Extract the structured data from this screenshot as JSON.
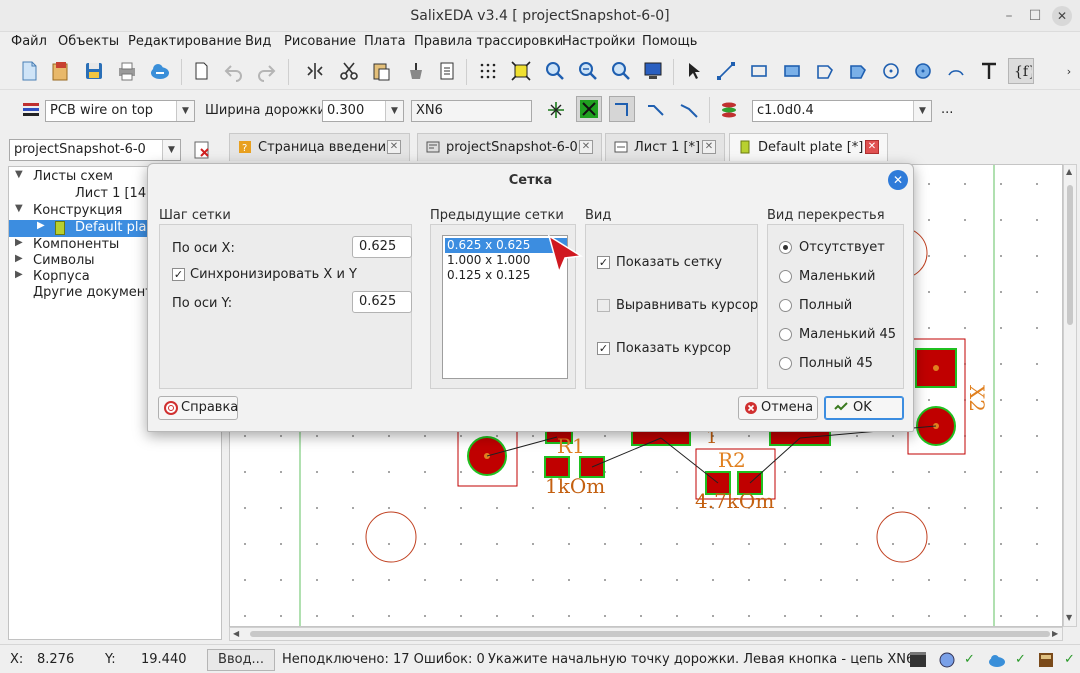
{
  "window": {
    "title": "SalixEDA v3.4 [ projectSnapshot-6-0]"
  },
  "menu": [
    "Файл",
    "Объекты",
    "Редактирование",
    "Вид",
    "Рисование",
    "Плата",
    "Правила трассировки",
    "Настройки",
    "Помощь"
  ],
  "toolbar2": {
    "layer_combo": "PCB wire on top",
    "width_label": "Ширина дорожки:",
    "width_value": "0.300",
    "net_value": "XN6",
    "rule_combo": "c1.0d0.4",
    "more": "..."
  },
  "project_combo": "projectSnapshot-6-0",
  "tabs": [
    {
      "label": "Страница введения"
    },
    {
      "label": "projectSnapshot-6-0"
    },
    {
      "label": "Лист 1 [*]"
    },
    {
      "label": "Default plate [*]"
    }
  ],
  "tree": {
    "items": [
      {
        "label": "Листы схем"
      },
      {
        "label": "Лист 1 [14"
      },
      {
        "label": "Конструкция"
      },
      {
        "label": "Default pla"
      },
      {
        "label": "Компоненты"
      },
      {
        "label": "Символы"
      },
      {
        "label": "Корпуса"
      },
      {
        "label": "Другие документ"
      }
    ]
  },
  "canvas": {
    "labels": {
      "r1": "R1",
      "r1_value": "1kOm",
      "r2": "R2",
      "r2_value": "4.7kOm",
      "x2": "X2",
      "partial": "1"
    },
    "colors": {
      "copper": "#c00000",
      "outline": "#20c020",
      "silk": "#e08020",
      "hole": "#c04020",
      "board_edge": "#60c060"
    }
  },
  "dialog": {
    "title": "Сетка",
    "grid_step": {
      "title": "Шаг сетки",
      "x_label": "По оси X:",
      "x_value": "0.625",
      "sync_label": "Синхронизировать X и Y",
      "sync_checked": true,
      "y_label": "По оси Y:",
      "y_value": "0.625"
    },
    "previous": {
      "title": "Предыдущие сетки",
      "items": [
        "0.625 x 0.625",
        "1.000 x 1.000",
        "0.125 x 0.125"
      ]
    },
    "view": {
      "title": "Вид",
      "show_grid": "Показать сетку",
      "align_cursor": "Выравнивать курсор",
      "show_cursor": "Показать курсор"
    },
    "crosshair": {
      "title": "Вид перекрестья",
      "options": [
        "Отсутствует",
        "Маленький",
        "Полный",
        "Маленький 45",
        "Полный 45"
      ]
    },
    "help_button": "Справка",
    "cancel_button": "Отмена",
    "ok_button": "OK"
  },
  "status": {
    "x_label": "X:",
    "x_value": "8.276",
    "y_label": "Y:",
    "y_value": "19.440",
    "input_button": "Ввод...",
    "unconnected": "Неподключено: 17 Ошибок: 0",
    "hint": "Укажите начальную точку дорожки. Левая кнопка - цепь XN6."
  }
}
